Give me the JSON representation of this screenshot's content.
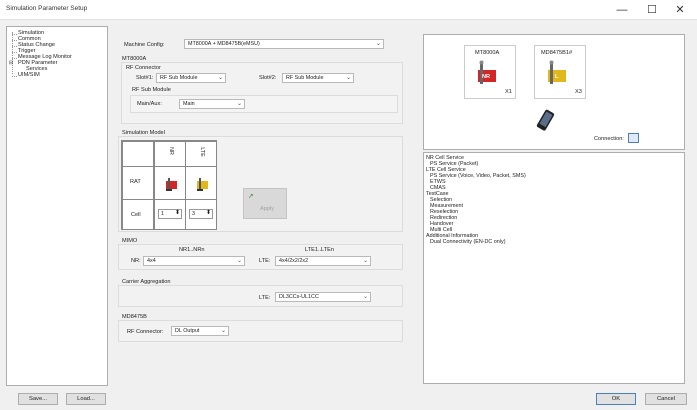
{
  "window": {
    "title": "Simulation Parameter Setup",
    "minimize": "—",
    "maximize": "☐",
    "close": "✕"
  },
  "tree": {
    "items": [
      {
        "label": "Simulation"
      },
      {
        "label": "Common"
      },
      {
        "label": "Status Change"
      },
      {
        "label": "Trigger"
      },
      {
        "label": "Message Log Monitor"
      },
      {
        "label": "PDN Parameter",
        "expander": "⊟"
      },
      {
        "label": "Services"
      },
      {
        "label": "UIM/SIM"
      }
    ]
  },
  "main": {
    "machine_config_label": "Machine Config:",
    "machine_config_value": "MT8000A + MD8475B(eMSU)",
    "mt8000a_header": "MT8000A",
    "rf_connector_header": "RF Connector",
    "slot1_label": "Slot#1:",
    "slot1_value": "RF Sub Module",
    "slot2_label": "Slot#2:",
    "slot2_value": "RF Sub Module",
    "rf_sub_module_header": "RF Sub Module",
    "main_aux_label": "Main/Aux:",
    "main_aux_value": "Main",
    "sim_model_header": "Simulation Model",
    "col_nr": "NR",
    "col_lte": "LTE",
    "row_rat": "RAT",
    "row_cell": "Cell",
    "cell_nr_value": "1",
    "cell_lte_value": "3",
    "apply_label": "Apply",
    "mimo_header": "MIMO",
    "mimo_nr_header": "NR1..NRn",
    "mimo_lte_header": "LTE1..LTEn",
    "mimo_nr_label": "NR:",
    "mimo_nr_value": "4x4",
    "mimo_lte_label": "LTE:",
    "mimo_lte_value": "4x4/2x2/2x2",
    "ca_header": "Carrier Aggregation",
    "ca_lte_label": "LTE:",
    "ca_lte_value": "DL3CCs-UL1CC",
    "md8475b_header": "MD8475B",
    "rf_connector_label": "RF Connector:",
    "rf_connector_value": "DL Output"
  },
  "diagram": {
    "mt8000a_label": "MT8000A",
    "md8475b_label": "MD8475B1#",
    "nr_badge": "NR",
    "lte_badge": "L",
    "nr_count": "X1",
    "lte_count": "X3",
    "connection_label": "Connection:"
  },
  "info": {
    "lines": [
      "NR Cell Service",
      "PS Service (Packet)",
      "LTE Cell Service",
      "PS Service (Voice, Video, Packet, SMS)",
      "ETWS",
      "CMAS",
      "TestCase",
      "Selection",
      "Measurement",
      "Reselection",
      "Redirection",
      "Handover",
      "Multi Cell",
      "Additional Information",
      "Dual Connectivity (EN-DC only)"
    ]
  },
  "buttons": {
    "save": "Save...",
    "load": "Load...",
    "ok": "OK",
    "cancel": "Cancel"
  },
  "colors": {
    "nr_red": "#d32626",
    "lte_yellow": "#e0b81c",
    "accent_blue": "#4a7fc8"
  }
}
